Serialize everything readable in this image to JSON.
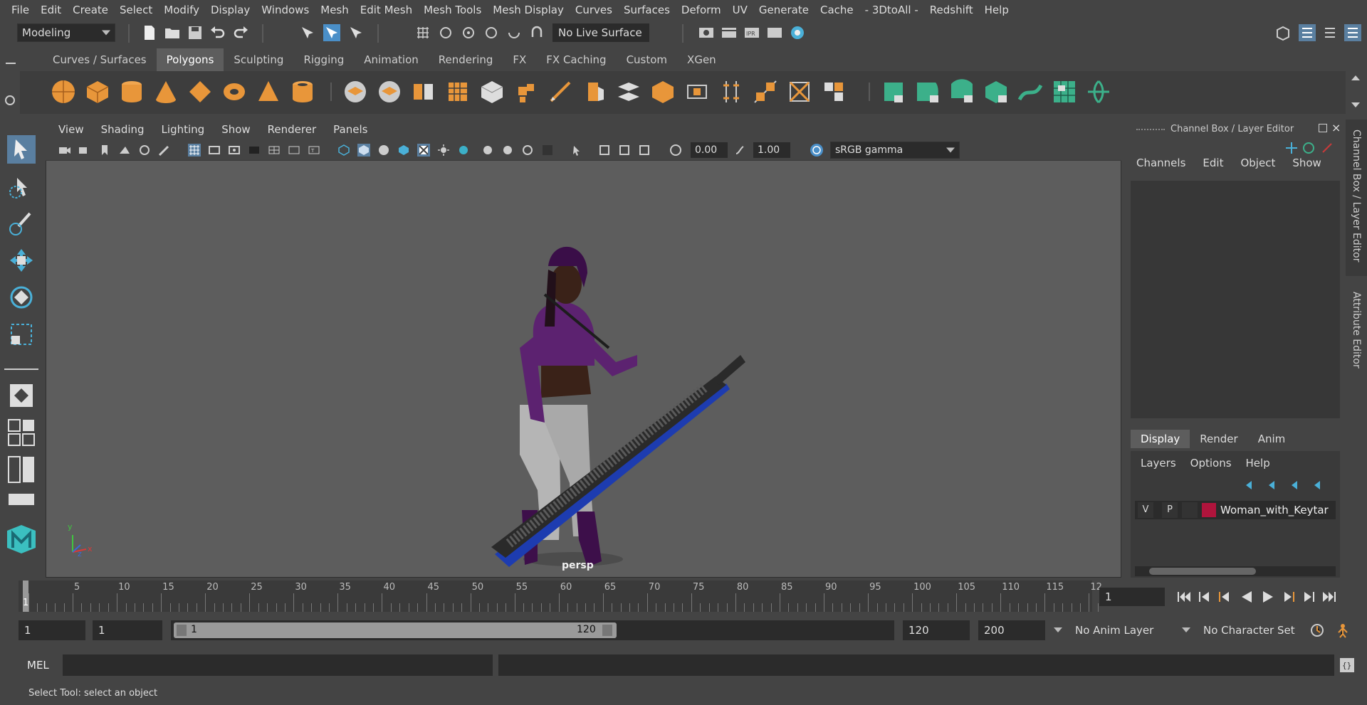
{
  "menubar": [
    "File",
    "Edit",
    "Create",
    "Select",
    "Modify",
    "Display",
    "Windows",
    "Mesh",
    "Edit Mesh",
    "Mesh Tools",
    "Mesh Display",
    "Curves",
    "Surfaces",
    "Deform",
    "UV",
    "Generate",
    "Cache",
    "- 3DtoAll -",
    "Redshift",
    "Help"
  ],
  "status": {
    "mode": "Modeling",
    "live_surface": "No Live Surface"
  },
  "shelf": {
    "tabs": [
      "Curves / Surfaces",
      "Polygons",
      "Sculpting",
      "Rigging",
      "Animation",
      "Rendering",
      "FX",
      "FX Caching",
      "Custom",
      "XGen"
    ],
    "active_tab": "Polygons"
  },
  "viewport": {
    "menu": [
      "View",
      "Shading",
      "Lighting",
      "Show",
      "Renderer",
      "Panels"
    ],
    "exposure": "0.00",
    "gamma": "1.00",
    "colorspace": "sRGB gamma",
    "camera_label": "persp",
    "axis_y": "y",
    "axis_x": "x",
    "axis_z": "z"
  },
  "channelbox": {
    "title": "Channel Box / Layer Editor",
    "menu": [
      "Channels",
      "Edit",
      "Object",
      "Show"
    ]
  },
  "layers": {
    "tabs": [
      "Display",
      "Render",
      "Anim"
    ],
    "active_tab": "Display",
    "menu": [
      "Layers",
      "Options",
      "Help"
    ],
    "row": {
      "v": "V",
      "p": "P",
      "name": "Woman_with_Keytar",
      "color": "#b0143c"
    }
  },
  "side_tabs": [
    "Channel Box / Layer Editor",
    "Attribute Editor"
  ],
  "timeline": {
    "ticks": [
      "5",
      "10",
      "15",
      "20",
      "25",
      "30",
      "35",
      "40",
      "45",
      "50",
      "55",
      "60",
      "65",
      "70",
      "75",
      "80",
      "85",
      "90",
      "95",
      "100",
      "105",
      "110",
      "115",
      "12"
    ],
    "current_marker": "1",
    "current_frame": "1"
  },
  "range": {
    "start": "1",
    "anim_start": "1",
    "slider_start": "1",
    "slider_end": "120",
    "anim_end": "120",
    "end": "200",
    "anim_layer": "No Anim Layer",
    "character_set": "No Character Set"
  },
  "cmd": {
    "label": "MEL"
  },
  "help": {
    "text": "Select Tool: select an object"
  },
  "colors": {
    "shelf_orange": "#e8963a",
    "shelf_teal": "#3cb08a",
    "accent_blue": "#4a8fc8"
  }
}
